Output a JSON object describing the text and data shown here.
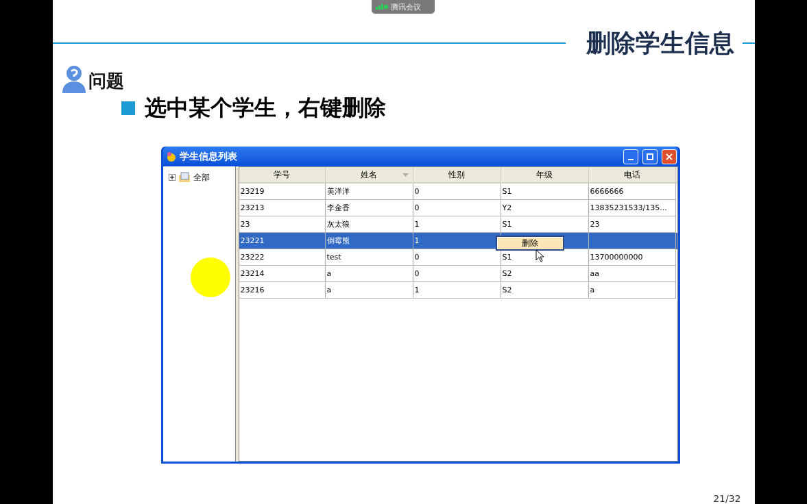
{
  "meeting_badge": {
    "label": "腾讯会议"
  },
  "slide": {
    "title": "删除学生信息",
    "section": "问题",
    "bullet": "选中某个学生，右键删除",
    "page": "21/32"
  },
  "window": {
    "title": "学生信息列表",
    "tree": [
      {
        "label": "全部",
        "expanded": false
      }
    ],
    "table": {
      "columns": [
        {
          "label": "学号",
          "sorted": false
        },
        {
          "label": "姓名",
          "sorted": true
        },
        {
          "label": "性别",
          "sorted": false
        },
        {
          "label": "年级",
          "sorted": false
        },
        {
          "label": "电话",
          "sorted": false
        }
      ],
      "rows": [
        {
          "selected": false,
          "cells": [
            "23219",
            "美洋洋",
            "0",
            "S1",
            "6666666"
          ]
        },
        {
          "selected": false,
          "cells": [
            "23213",
            "李金香",
            "0",
            "Y2",
            "13835231533/135..."
          ]
        },
        {
          "selected": false,
          "cells": [
            "23",
            "灰太狼",
            "1",
            "S1",
            "23"
          ]
        },
        {
          "selected": true,
          "cells": [
            "23221",
            "倒霉熊",
            "1"
          ]
        },
        {
          "selected": false,
          "cells": [
            "23222",
            "test",
            "0",
            "S1",
            "13700000000"
          ]
        },
        {
          "selected": false,
          "cells": [
            "23214",
            "a",
            "0",
            "S2",
            "aa"
          ]
        },
        {
          "selected": false,
          "cells": [
            "23216",
            "a",
            "1",
            "S2",
            "a"
          ]
        }
      ]
    },
    "context_menu": {
      "items": [
        "删除"
      ]
    }
  }
}
